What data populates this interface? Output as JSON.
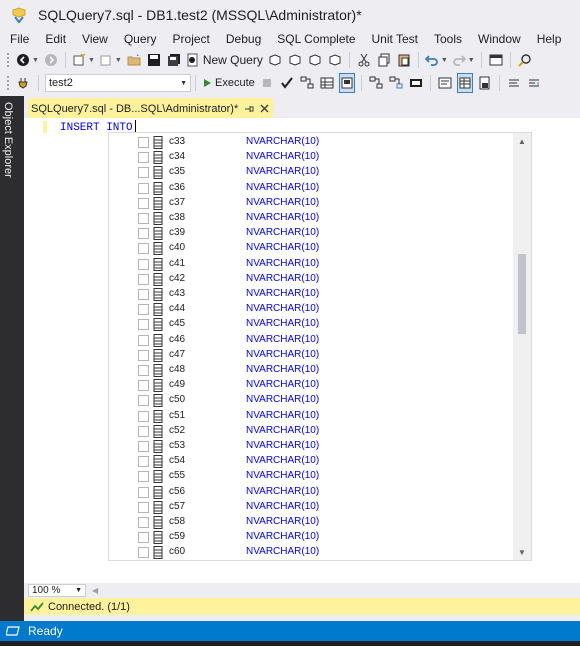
{
  "window": {
    "title": "SQLQuery7.sql - DB1.test2 (MSSQL\\Administrator)*"
  },
  "menu": [
    "File",
    "Edit",
    "View",
    "Query",
    "Project",
    "Debug",
    "SQL Complete",
    "Unit Test",
    "Tools",
    "Window",
    "Help"
  ],
  "toolbar": {
    "new_query_label": "New Query",
    "database": "test2",
    "execute_label": "Execute"
  },
  "sidebar": {
    "label": "Object Explorer"
  },
  "tab": {
    "label": "SQLQuery7.sql - DB...SQL\\Administrator)*"
  },
  "editor": {
    "code": "INSERT INTO"
  },
  "columns": [
    {
      "name": "c33",
      "type": "NVARCHAR(10)"
    },
    {
      "name": "c34",
      "type": "NVARCHAR(10)"
    },
    {
      "name": "c35",
      "type": "NVARCHAR(10)"
    },
    {
      "name": "c36",
      "type": "NVARCHAR(10)"
    },
    {
      "name": "c37",
      "type": "NVARCHAR(10)"
    },
    {
      "name": "c38",
      "type": "NVARCHAR(10)"
    },
    {
      "name": "c39",
      "type": "NVARCHAR(10)"
    },
    {
      "name": "c40",
      "type": "NVARCHAR(10)"
    },
    {
      "name": "c41",
      "type": "NVARCHAR(10)"
    },
    {
      "name": "c42",
      "type": "NVARCHAR(10)"
    },
    {
      "name": "c43",
      "type": "NVARCHAR(10)"
    },
    {
      "name": "c44",
      "type": "NVARCHAR(10)"
    },
    {
      "name": "c45",
      "type": "NVARCHAR(10)"
    },
    {
      "name": "c46",
      "type": "NVARCHAR(10)"
    },
    {
      "name": "c47",
      "type": "NVARCHAR(10)"
    },
    {
      "name": "c48",
      "type": "NVARCHAR(10)"
    },
    {
      "name": "c49",
      "type": "NVARCHAR(10)"
    },
    {
      "name": "c50",
      "type": "NVARCHAR(10)"
    },
    {
      "name": "c51",
      "type": "NVARCHAR(10)"
    },
    {
      "name": "c52",
      "type": "NVARCHAR(10)"
    },
    {
      "name": "c53",
      "type": "NVARCHAR(10)"
    },
    {
      "name": "c54",
      "type": "NVARCHAR(10)"
    },
    {
      "name": "c55",
      "type": "NVARCHAR(10)"
    },
    {
      "name": "c56",
      "type": "NVARCHAR(10)"
    },
    {
      "name": "c57",
      "type": "NVARCHAR(10)"
    },
    {
      "name": "c58",
      "type": "NVARCHAR(10)"
    },
    {
      "name": "c59",
      "type": "NVARCHAR(10)"
    },
    {
      "name": "c60",
      "type": "NVARCHAR(10)"
    }
  ],
  "zoom": "100 %",
  "connection": {
    "status": "Connected. (1/1)"
  },
  "status": {
    "text": "Ready"
  },
  "colors": {
    "accent": "#007acc",
    "keyword": "#0000ff",
    "highlight": "#fff29d",
    "sidebar": "#2d2d30"
  }
}
